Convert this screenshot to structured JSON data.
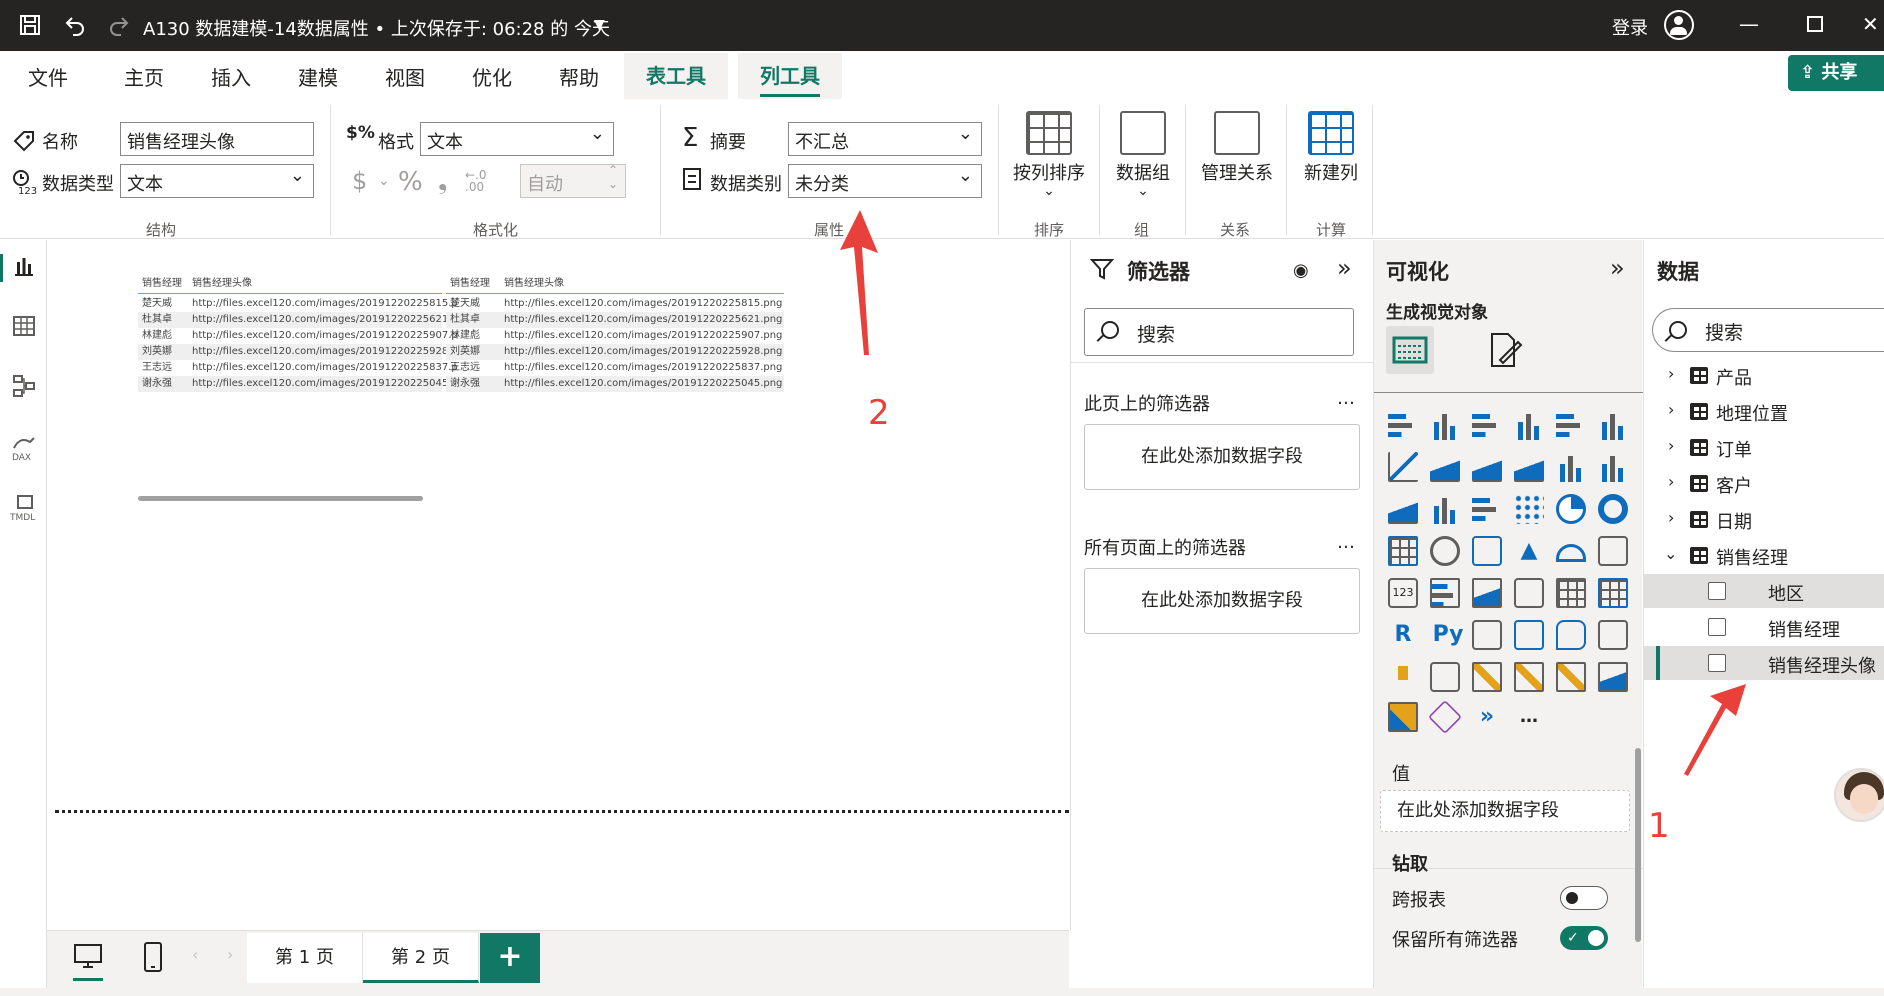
{
  "titlebar": {
    "title": "A130 数据建模-14数据属性 • 上次保存于: 06:28 的 今天",
    "signin": "登录"
  },
  "menu": {
    "tabs": [
      "文件",
      "主页",
      "插入",
      "建模",
      "视图",
      "优化",
      "帮助",
      "表工具",
      "列工具"
    ],
    "share": "共享"
  },
  "ribbon": {
    "name_label": "名称",
    "name_value": "销售经理头像",
    "datatype_label": "数据类型",
    "datatype_value": "文本",
    "group_structure": "结构",
    "format_label": "格式",
    "format_value": "文本",
    "auto_value": "自动",
    "group_format": "格式化",
    "summary_label": "摘要",
    "summary_value": "不汇总",
    "category_label": "数据类别",
    "category_value": "未分类",
    "group_props": "属性",
    "sort_label": "按列排序",
    "group_sort": "排序",
    "datagroup_label": "数据组",
    "group_group": "组",
    "manage_rel_label": "管理关系",
    "group_rel": "关系",
    "new_col_label": "新建列",
    "group_calc": "计算"
  },
  "canvas": {
    "col_mgr": "销售经理",
    "col_img": "销售经理头像",
    "rows": [
      {
        "mgr": "楚天威",
        "url1": "http://files.excel120.com/images/20191220225815.p",
        "url2": "http://files.excel120.com/images/20191220225815.png"
      },
      {
        "mgr": "杜其卓",
        "url1": "http://files.excel120.com/images/20191220225621.p",
        "url2": "http://files.excel120.com/images/20191220225621.png"
      },
      {
        "mgr": "林建彪",
        "url1": "http://files.excel120.com/images/20191220225907.p",
        "url2": "http://files.excel120.com/images/20191220225907.png"
      },
      {
        "mgr": "刘英娜",
        "url1": "http://files.excel120.com/images/20191220225928.p",
        "url2": "http://files.excel120.com/images/20191220225928.png"
      },
      {
        "mgr": "王志远",
        "url1": "http://files.excel120.com/images/20191220225837.p",
        "url2": "http://files.excel120.com/images/20191220225837.png"
      },
      {
        "mgr": "谢永强",
        "url1": "http://files.excel120.com/images/20191220225045.p",
        "url2": "http://files.excel120.com/images/20191220225045.png"
      }
    ]
  },
  "pages": {
    "page1": "第 1 页",
    "page2": "第 2 页",
    "add": "+"
  },
  "filters": {
    "title": "筛选器",
    "search": "搜索",
    "this_page": "此页上的筛选器",
    "all_pages": "所有页面上的筛选器",
    "add_field": "在此处添加数据字段",
    "more": "…"
  },
  "viz": {
    "title": "可视化",
    "subtitle": "生成视觉对象",
    "values_label": "值",
    "add_field": "在此处添加数据字段",
    "drill_label": "钻取",
    "cross_report": "跨报表",
    "keep_filters": "保留所有筛选器",
    "more": "…",
    "text_icons": [
      "R",
      "Py"
    ]
  },
  "data": {
    "title": "数据",
    "search": "搜索",
    "tables": [
      "产品",
      "地理位置",
      "订单",
      "客户",
      "日期",
      "销售经理"
    ],
    "fields": [
      "地区",
      "销售经理",
      "销售经理头像"
    ]
  },
  "annotations": {
    "n1": "1",
    "n2": "2"
  },
  "colors": {
    "accent": "#117865",
    "annotation": "#e8403a",
    "titlebar": "#252423"
  }
}
